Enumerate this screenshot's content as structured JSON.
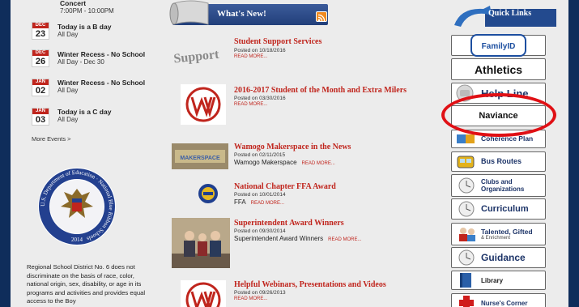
{
  "events": {
    "top_partial": {
      "title": "Concert",
      "time": "7:00PM - 10:00PM"
    },
    "items": [
      {
        "month": "DEC",
        "day": "23",
        "title": "Today is a B day",
        "sub": "All Day"
      },
      {
        "month": "DEC",
        "day": "26",
        "title": "Winter Recess - No School",
        "sub": "All Day - Dec 30"
      },
      {
        "month": "JAN",
        "day": "02",
        "title": "Winter Recess - No School",
        "sub": "All Day"
      },
      {
        "month": "JAN",
        "day": "03",
        "title": "Today is a C day",
        "sub": "All Day"
      }
    ],
    "more": "More Events >"
  },
  "seal": {
    "ring_text": "U.S. Department of Education · National Blue Ribbon Schools",
    "year": "2014"
  },
  "notice": "Regional School District No. 6 does not discriminate on the basis of race, color, national origin, sex, disability, or age in its programs and activities and provides equal access to the Boy",
  "news": {
    "header": "What's New!",
    "items": [
      {
        "title": "Student Support Services",
        "posted": "Posted on 10/18/2016",
        "excerpt": "",
        "read_more": "READ MORE..."
      },
      {
        "title": "2016-2017 Student of the Month and Extra Milers",
        "posted": "Posted on 03/30/2016",
        "excerpt": "",
        "read_more": "READ MORE..."
      },
      {
        "title": "Wamogo Makerspace in the News",
        "posted": "Posted on 02/11/2015",
        "excerpt": "Wamogo Makerspace",
        "read_more": "READ MORE..."
      },
      {
        "title": "National Chapter FFA Award",
        "posted": "Posted on 10/01/2014",
        "excerpt": "FFA",
        "read_more": "READ MORE..."
      },
      {
        "title": "Superintendent Award Winners",
        "posted": "Posted on 09/30/2014",
        "excerpt": "Superintendent Award Winners",
        "read_more": "READ MORE..."
      },
      {
        "title": "Helpful Webinars, Presentations and Videos",
        "posted": "Posted on 09/26/2013",
        "excerpt": "",
        "read_more": "READ MORE..."
      }
    ],
    "thumb_text": {
      "support": "Support",
      "makerspace": "MAKERSPACE"
    }
  },
  "quick_links": {
    "header": "Quick Links",
    "items": [
      {
        "label": "FamilyID"
      },
      {
        "label": "Athletics"
      },
      {
        "label": "Help Line"
      },
      {
        "label": "Naviance"
      },
      {
        "label": "Coherence Plan"
      },
      {
        "label": "Bus Routes"
      },
      {
        "label": "Clubs and Organizations"
      },
      {
        "label": "Curriculum"
      },
      {
        "label": "Talented, Gifted",
        "sub": "& Enrichment"
      },
      {
        "label": "Guidance"
      },
      {
        "label": "Library"
      },
      {
        "label": "Nurse's Corner"
      }
    ]
  },
  "colors": {
    "accent_red": "#c0251d",
    "navy": "#1d3468",
    "highlight_circle": "#e01015"
  }
}
